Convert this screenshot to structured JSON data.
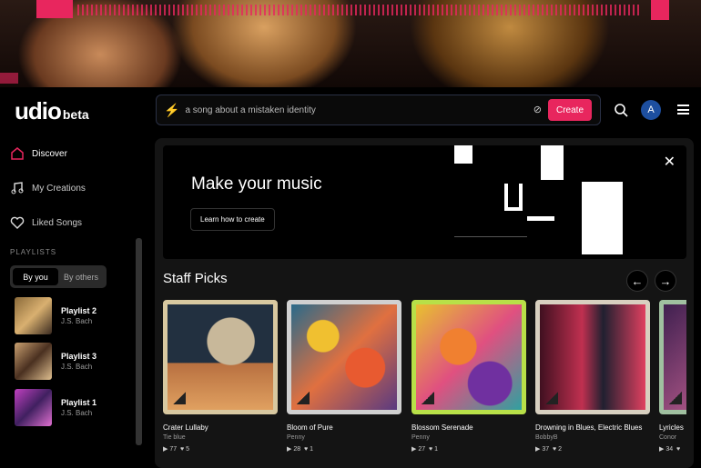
{
  "logo": {
    "name": "udio",
    "tag": "beta"
  },
  "search": {
    "placeholder": "a song about a mistaken identity",
    "create_label": "Create"
  },
  "user": {
    "avatar_letter": "A"
  },
  "sidebar": {
    "items": [
      {
        "label": "Discover",
        "icon": "home-icon"
      },
      {
        "label": "My Creations",
        "icon": "music-note-icon"
      },
      {
        "label": "Liked Songs",
        "icon": "heart-icon"
      }
    ],
    "playlists_header": "PLAYLISTS",
    "tabs": [
      "By you",
      "By others"
    ],
    "playlists": [
      {
        "title": "Playlist 2",
        "artist": "J.S. Bach"
      },
      {
        "title": "Playlist 3",
        "artist": "J.S. Bach"
      },
      {
        "title": "Playlist 1",
        "artist": "J.S. Bach"
      }
    ]
  },
  "banner": {
    "title": "Make your music",
    "button": "Learn how to create"
  },
  "staff_picks": {
    "title": "Staff Picks",
    "cards": [
      {
        "title": "Crater Lullaby",
        "artist": "Tie blue",
        "plays": "77",
        "likes": "5"
      },
      {
        "title": "Bloom of Pure",
        "artist": "Penny",
        "plays": "28",
        "likes": "1"
      },
      {
        "title": "Blossom Serenade",
        "artist": "Penny",
        "plays": "27",
        "likes": "1"
      },
      {
        "title": "Drowning in Blues, Electric Blues",
        "artist": "BobbyB",
        "plays": "37",
        "likes": "2"
      },
      {
        "title": "Lyricles",
        "artist": "Conor",
        "plays": "34",
        "likes": ""
      }
    ]
  },
  "colors": {
    "accent": "#e8265e"
  }
}
